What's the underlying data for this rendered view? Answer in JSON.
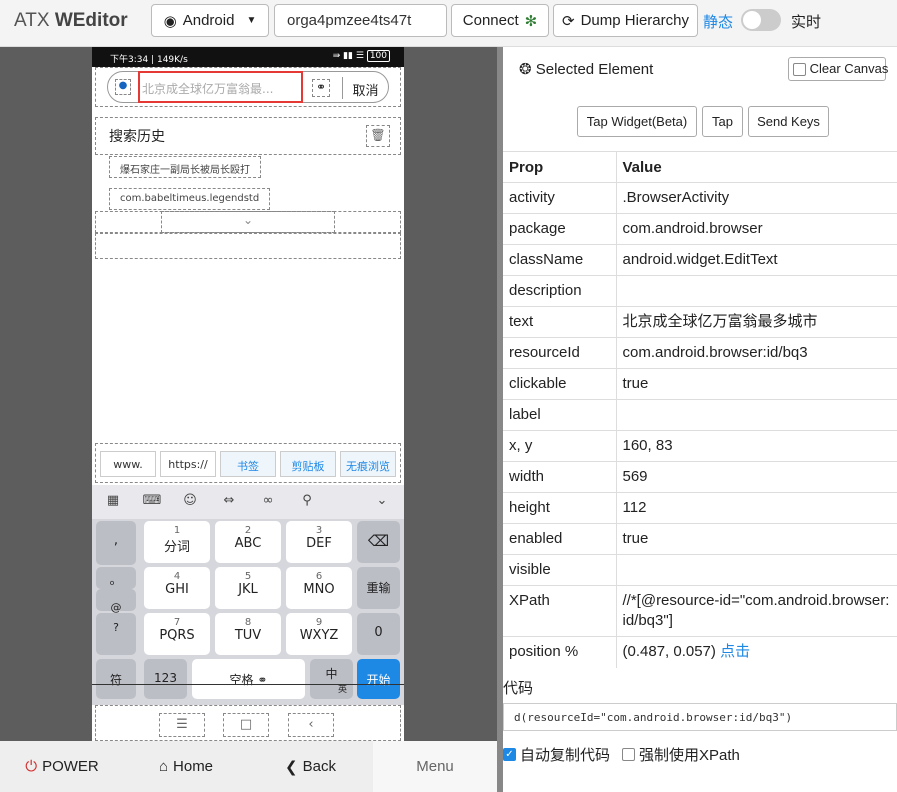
{
  "topbar": {
    "brand_prefix": "ATX ",
    "brand_name": "WEditor",
    "platform": "Android",
    "device_id": "orga4pmzee4ts47t",
    "connect_label": "Connect",
    "dump_label": "Dump Hierarchy",
    "mode_static": "静态",
    "mode_live": "实时"
  },
  "phone": {
    "status_time": "下午3:34 | 149K/s",
    "status_battery": "100",
    "search_placeholder": "北京成全球亿万富翁最...",
    "cancel_label": "取消",
    "history_title": "搜索历史",
    "history_items": [
      "爆石家庄一副局长被局长殴打",
      "com.babeltimeus.legendstd"
    ],
    "quick_keys": [
      "www.",
      "https://",
      "书签",
      "剪贴板",
      "无痕浏览"
    ],
    "keys": {
      "row1": [
        {
          "sub": "1",
          "main": "分词"
        },
        {
          "sub": "2",
          "main": "ABC"
        },
        {
          "sub": "3",
          "main": "DEF"
        }
      ],
      "row2": [
        {
          "sub": "4",
          "main": "GHI"
        },
        {
          "sub": "5",
          "main": "JKL"
        },
        {
          "sub": "6",
          "main": "MNO"
        }
      ],
      "row3": [
        {
          "sub": "7",
          "main": "PQRS"
        },
        {
          "sub": "8",
          "main": "TUV"
        },
        {
          "sub": "9",
          "main": "WXYZ"
        }
      ],
      "left_col": [
        ",",
        "。",
        "@",
        "?"
      ],
      "reenter": "重输",
      "zero": "0",
      "symbols": "符",
      "num": "123",
      "space": "空格",
      "lang_main": "中",
      "lang_sub": "英",
      "go": "开始"
    }
  },
  "controls": {
    "power": "POWER",
    "home": "Home",
    "back": "Back",
    "menu": "Menu"
  },
  "inspector": {
    "title": "Selected Element",
    "clear_canvas": "Clear Canvas",
    "tap_widget": "Tap Widget(Beta)",
    "tap": "Tap",
    "send_keys": "Send Keys",
    "col_prop": "Prop",
    "col_value": "Value",
    "rows": [
      {
        "prop": "activity",
        "value": ".BrowserActivity"
      },
      {
        "prop": "package",
        "value": "com.android.browser"
      },
      {
        "prop": "className",
        "value": "android.widget.EditText"
      },
      {
        "prop": "description",
        "value": ""
      },
      {
        "prop": "text",
        "value": "北京成全球亿万富翁最多城市"
      },
      {
        "prop": "resourceId",
        "value": "com.android.browser:id/bq3"
      },
      {
        "prop": "clickable",
        "value": "true"
      },
      {
        "prop": "label",
        "value": ""
      },
      {
        "prop": "x, y",
        "value": "160, 83"
      },
      {
        "prop": "width",
        "value": "569"
      },
      {
        "prop": "height",
        "value": "112"
      },
      {
        "prop": "enabled",
        "value": "true"
      },
      {
        "prop": "visible",
        "value": ""
      },
      {
        "prop": "XPath",
        "value": "//*[@resource-id=\"com.android.browser:id/bq3\"]"
      }
    ],
    "position_prop": "position %",
    "position_value": "(0.487, 0.057)",
    "position_link": "点击",
    "code_label": "代码",
    "code": "d(resourceId=\"com.android.browser:id/bq3\")",
    "auto_copy": "自动复制代码",
    "force_xpath": "强制使用XPath"
  }
}
